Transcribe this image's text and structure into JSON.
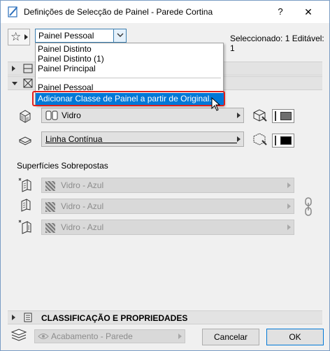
{
  "window": {
    "title": "Definições de Selecção de Painel - Parede Cortina",
    "help_label": "?",
    "close_label": "✕"
  },
  "toolbar": {
    "favorites_icon": "star-icon",
    "panel_class_value": "Painel Pessoal",
    "selected_info": "Seleccionado: 1 Editável: 1"
  },
  "dropdown": {
    "items": [
      "Painel Distinto",
      "Painel Distinto (1)",
      "Painel Principal",
      "Painel Pessoal"
    ],
    "action_label": "Adicionar Classe de Painel a partir de Original..."
  },
  "model": {
    "surface_value": "Vidro",
    "line_value": "Linha Contínua",
    "pen_colors": {
      "surface": "#6e6e6e",
      "line": "#000000"
    }
  },
  "overrides": {
    "heading": "Superfícies Sobrepostas",
    "items": [
      "Vidro - Azul",
      "Vidro - Azul",
      "Vidro - Azul"
    ]
  },
  "classification": {
    "label": "CLASSIFICAÇÃO E PROPRIEDADES"
  },
  "footer": {
    "layer_value": "Acabamento - Parede",
    "cancel_label": "Cancelar",
    "ok_label": "OK"
  },
  "colors": {
    "accent": "#0078d7",
    "highlight_frame": "#e0201b"
  }
}
